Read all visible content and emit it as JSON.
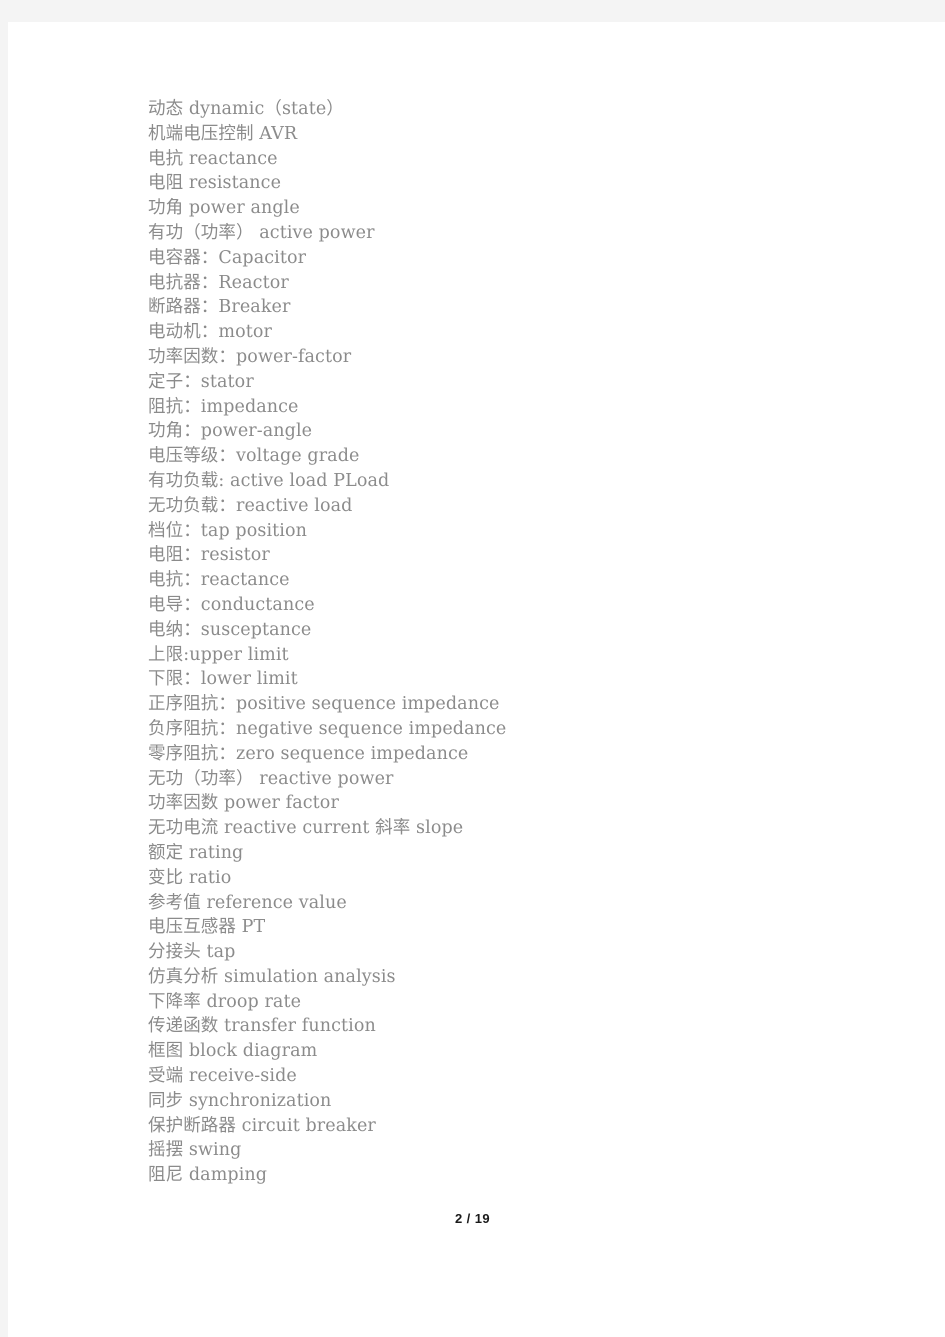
{
  "viewer": {
    "background_color": "#f4f4f4",
    "page_background_color": "#ffffff"
  },
  "document": {
    "text_color": "#8b8b8b",
    "lines": [
      "动态 dynamic（state）",
      "机端电压控制 AVR",
      "电抗 reactance",
      "电阻 resistance",
      "功角 power angle",
      "有功（功率） active power",
      "电容器：Capacitor",
      "电抗器：Reactor",
      "断路器：Breaker",
      "电动机：motor",
      "功率因数：power-factor",
      "定子：stator",
      "阻抗：impedance",
      "功角：power-angle",
      "电压等级：voltage grade",
      "有功负载: active load PLoad",
      "无功负载：reactive load",
      "档位：tap position",
      "电阻：resistor",
      "电抗：reactance",
      "电导：conductance",
      "电纳：susceptance",
      "上限:upper limit",
      "下限：lower limit",
      "正序阻抗：positive sequence impedance",
      "负序阻抗：negative sequence impedance",
      "零序阻抗：zero sequence impedance",
      "无功（功率） reactive power",
      "功率因数 power factor",
      "无功电流 reactive current 斜率 slope",
      "额定 rating",
      "变比 ratio",
      "参考值 reference value",
      "电压互感器 PT",
      "分接头 tap",
      "仿真分析 simulation analysis",
      "下降率 droop rate",
      "传递函数 transfer function",
      "框图 block diagram",
      "受端 receive-side",
      "同步 synchronization",
      "保护断路器 circuit breaker",
      "摇摆 swing",
      "阻尼 damping"
    ]
  },
  "footer": {
    "page_indicator": "2 / 19",
    "current_page": "2",
    "total_pages": "19"
  }
}
